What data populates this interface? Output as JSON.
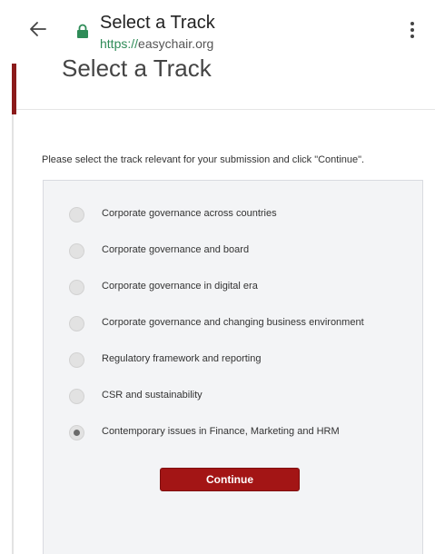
{
  "browser": {
    "title": "Select a Track",
    "url_scheme": "https://",
    "url_host": "easychair.org",
    "back_icon": "arrow-left-icon",
    "lock_icon": "lock-icon",
    "menu_icon": "more-vert-icon",
    "lock_color": "#2e8b57"
  },
  "page": {
    "heading": "Select a Track",
    "instruction": "Please select the track relevant for your submission and click \"Continue\"."
  },
  "tracks": [
    {
      "label": "Corporate governance across countries",
      "checked": false
    },
    {
      "label": "Corporate governance and board",
      "checked": false
    },
    {
      "label": "Corporate governance in digital era",
      "checked": false
    },
    {
      "label": "Corporate governance and changing business environment",
      "checked": false
    },
    {
      "label": "Regulatory framework and reporting",
      "checked": false
    },
    {
      "label": "CSR and sustainability",
      "checked": false
    },
    {
      "label": "Contemporary issues in Finance, Marketing and HRM",
      "checked": true
    }
  ],
  "actions": {
    "continue_label": "Continue",
    "accent_color": "#a31515"
  }
}
